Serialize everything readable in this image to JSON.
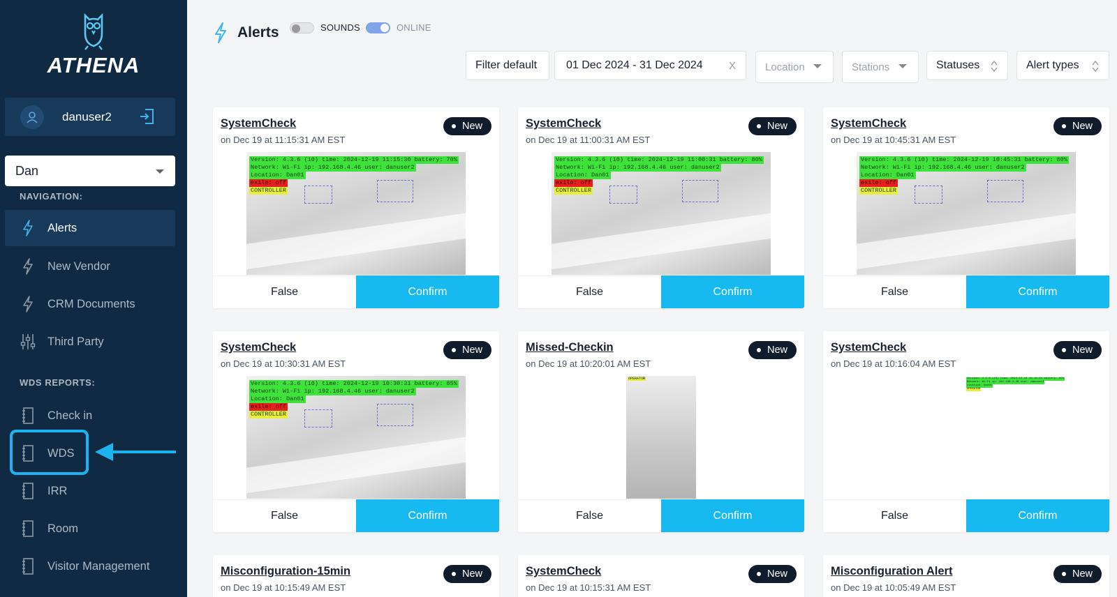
{
  "brand": {
    "name": "ATHENA"
  },
  "user": {
    "name": "danuser2"
  },
  "org_select": {
    "value": "Dan"
  },
  "nav": {
    "navigation_label": "NAVIGATION:",
    "items": [
      {
        "label": "Alerts",
        "icon": "bolt-icon"
      },
      {
        "label": "New Vendor",
        "icon": "bolt-icon"
      },
      {
        "label": "CRM Documents",
        "icon": "bolt-icon"
      },
      {
        "label": "Third Party",
        "icon": "sliders-icon"
      }
    ],
    "reports_label": "WDS REPORTS:",
    "reports": [
      {
        "label": "Check in",
        "icon": "notebook-icon"
      },
      {
        "label": "WDS",
        "icon": "notebook-icon"
      },
      {
        "label": "IRR",
        "icon": "notebook-icon"
      },
      {
        "label": "Room",
        "icon": "notebook-icon"
      },
      {
        "label": "Visitor Management",
        "icon": "notebook-icon"
      }
    ]
  },
  "header": {
    "title": "Alerts",
    "sounds_label": "SOUNDS",
    "online_label": "ONLINE"
  },
  "filters": {
    "filter_default": "Filter default",
    "date_range": "01 Dec 2024 - 31 Dec 2024",
    "clear": "X",
    "location": "Location",
    "stations": "Stations",
    "statuses": "Statuses",
    "alert_types": "Alert types"
  },
  "colors": {
    "sidebar": "#102a43",
    "accent": "#16b9f0",
    "badge": "#101b2b"
  },
  "card_buttons": {
    "false_label": "False",
    "confirm_label": "Confirm"
  },
  "cards": [
    {
      "title": "SystemCheck",
      "time": "on Dec 19 at 11:15:31 AM EST",
      "badge": "New",
      "overlay": [
        "Version: 4.3.6 (10)   time: 2024-12-19 11:15:30   battery: 70%",
        "Network: Wi-Fi   ip: 192.168.4.46   user: danuser2",
        "Location: Dan01",
        "exile: off",
        "CONTROLLER"
      ]
    },
    {
      "title": "SystemCheck",
      "time": "on Dec 19 at 11:00:31 AM EST",
      "badge": "New",
      "overlay": [
        "Version: 4.3.6 (10)   time: 2024-12-19 11:00:31   battery: 80%",
        "Network: Wi-Fi   ip: 192.168.4.46   user: danuser2",
        "Location: Dan01",
        "exile: off",
        "CONTROLLER"
      ]
    },
    {
      "title": "SystemCheck",
      "time": "on Dec 19 at 10:45:31 AM EST",
      "badge": "New",
      "overlay": [
        "Version: 4.3.6 (10)   time: 2024-12-19 10:45:31   battery: 80%",
        "Network: Wi-Fi   ip: 192.168.4.46   user: danuser2",
        "Location: Dan01",
        "exile: off",
        "CONTROLLER"
      ]
    },
    {
      "title": "SystemCheck",
      "time": "on Dec 19 at 10:30:31 AM EST",
      "badge": "New",
      "overlay": [
        "Version: 4.3.6 (10)   time: 2024-12-19 10:30:31   battery: 85%",
        "Network: Wi-Fi   ip: 192.168.4.46   user: danuser2",
        "Location: Dan01",
        "exile: off",
        "CONTROLLER"
      ]
    },
    {
      "title": "Missed-Checkin",
      "time": "on Dec 19 at 10:20:01 AM EST",
      "badge": "New",
      "overlay": [
        "OPERATOR"
      ]
    },
    {
      "title": "SystemCheck",
      "time": "on Dec 19 at 10:16:04 AM EST",
      "badge": "New",
      "overlay": [
        "Version: 4.3.6 (10)   time: 2024-12-19 10:16:04   battery: 85%",
        "Network: Wi-Fi   ip: 192.168.4.46   user: danuser2",
        "Location: Dan01",
        "OPERATOR"
      ]
    },
    {
      "title": "Misconfiguration-15min",
      "time": "on Dec 19 at 10:15:49 AM EST",
      "badge": "New"
    },
    {
      "title": "SystemCheck",
      "time": "on Dec 19 at 10:15:31 AM EST",
      "badge": "New"
    },
    {
      "title": "Misconfiguration Alert",
      "time": "on Dec 19 at 10:05:49 AM EST",
      "badge": "New"
    }
  ]
}
